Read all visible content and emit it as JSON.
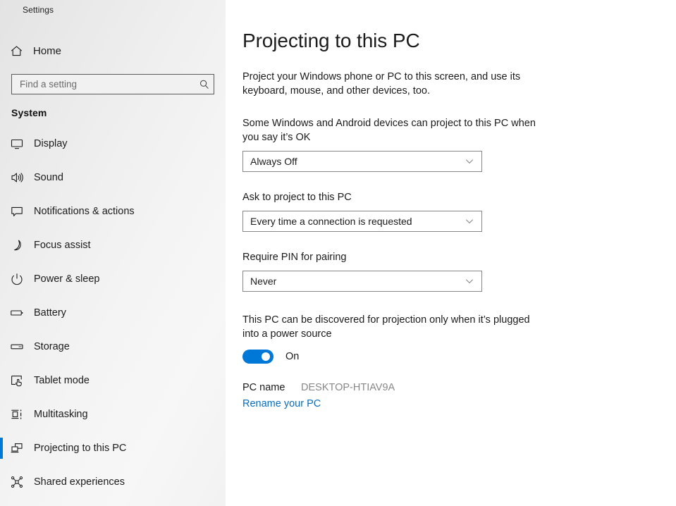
{
  "window": {
    "title": "Settings"
  },
  "sidebar": {
    "home": {
      "label": "Home",
      "icon": "home-icon"
    },
    "search": {
      "value": "",
      "placeholder": "Find a setting",
      "icon": "search-icon"
    },
    "section_title": "System",
    "items": [
      {
        "label": "Display",
        "icon": "monitor-icon",
        "selected": false
      },
      {
        "label": "Sound",
        "icon": "speaker-icon",
        "selected": false
      },
      {
        "label": "Notifications & actions",
        "icon": "chat-bubble-icon",
        "selected": false
      },
      {
        "label": "Focus assist",
        "icon": "moon-icon",
        "selected": false
      },
      {
        "label": "Power & sleep",
        "icon": "power-icon",
        "selected": false
      },
      {
        "label": "Battery",
        "icon": "battery-icon",
        "selected": false
      },
      {
        "label": "Storage",
        "icon": "storage-icon",
        "selected": false
      },
      {
        "label": "Tablet mode",
        "icon": "tablet-touch-icon",
        "selected": false
      },
      {
        "label": "Multitasking",
        "icon": "multitasking-icon",
        "selected": false
      },
      {
        "label": "Projecting to this PC",
        "icon": "projection-icon",
        "selected": true
      },
      {
        "label": "Shared experiences",
        "icon": "share-nodes-icon",
        "selected": false
      }
    ]
  },
  "main": {
    "page_title": "Projecting to this PC",
    "intro": "Project your Windows phone or PC to this screen, and use its keyboard, mouse, and other devices, too.",
    "fields": [
      {
        "label": "Some Windows and Android devices can project to this PC when you say it’s OK",
        "value": "Always Off"
      },
      {
        "label": "Ask to project to this PC",
        "value": "Every time a connection is requested"
      },
      {
        "label": "Require PIN for pairing",
        "value": "Never"
      }
    ],
    "power_setting": {
      "text": "This PC can be discovered for projection only when it’s plugged into a power source",
      "toggle_state": "On",
      "toggle_on": true
    },
    "pc_name": {
      "key": "PC name",
      "value": "DESKTOP-HTIAV9A",
      "rename_link": "Rename your PC"
    }
  },
  "colors": {
    "accent": "#0078d7",
    "link": "#0a6cbf",
    "sidebar_bg": "#f2f2f2",
    "text": "#1b1b1b",
    "muted": "#888888"
  }
}
